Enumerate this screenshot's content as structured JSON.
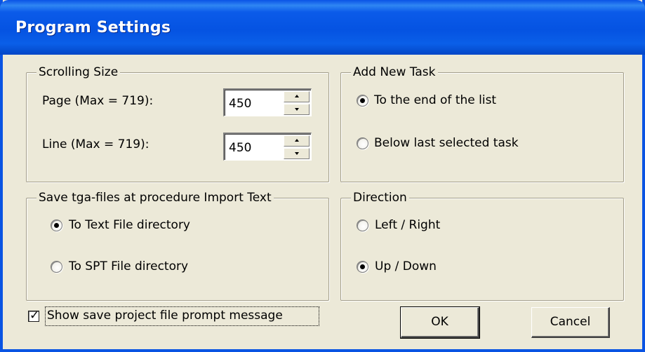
{
  "window": {
    "title": "Program Settings"
  },
  "scrolling_size": {
    "title": "Scrolling Size",
    "page": {
      "label": "Page (Max = 719):",
      "value": "450"
    },
    "line": {
      "label": "Line (Max = 719):",
      "value": "450"
    }
  },
  "add_new_task": {
    "title": "Add New Task",
    "options": [
      {
        "label": "To the end of the list",
        "checked": true
      },
      {
        "label": "Below last selected task",
        "checked": false
      }
    ]
  },
  "save_tga": {
    "title": "Save tga-files at procedure Import Text",
    "options": [
      {
        "label": "To Text File directory",
        "checked": true
      },
      {
        "label": "To SPT File directory",
        "checked": false
      }
    ]
  },
  "direction": {
    "title": "Direction",
    "options": [
      {
        "label": "Left / Right",
        "checked": false
      },
      {
        "label": "Up / Down",
        "checked": true
      }
    ]
  },
  "prompt_checkbox": {
    "label": "Show save project file prompt message",
    "checked": true
  },
  "buttons": {
    "ok": "OK",
    "cancel": "Cancel"
  }
}
